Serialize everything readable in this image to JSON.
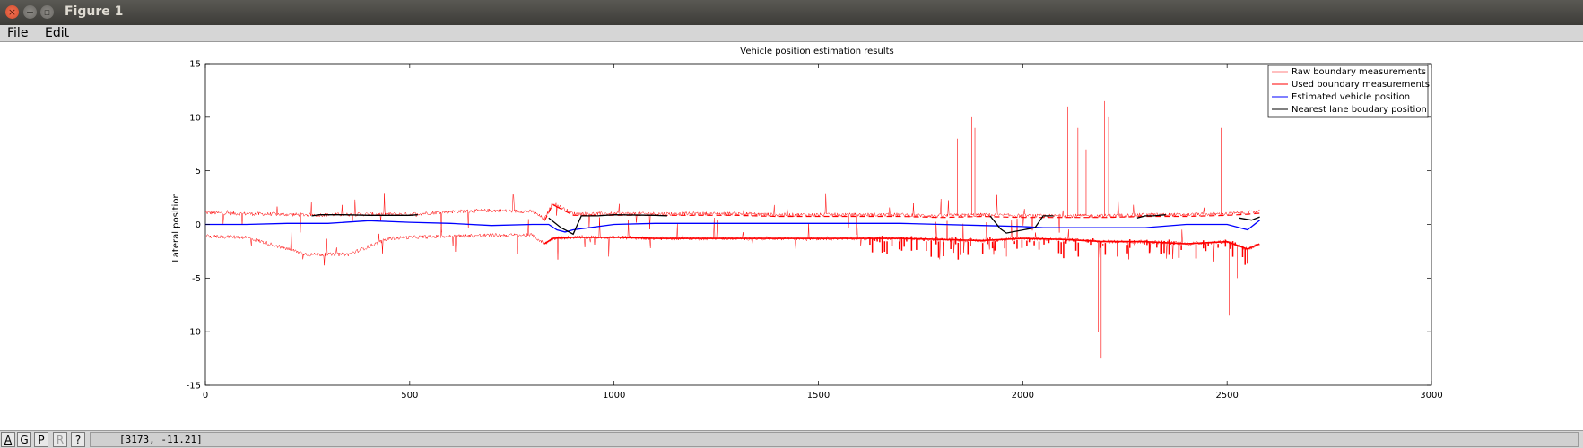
{
  "window": {
    "title": "Figure 1",
    "close_glyph": "×",
    "min_glyph": "−",
    "max_glyph": "▫"
  },
  "menu": {
    "file": "File",
    "edit": "Edit"
  },
  "status": {
    "buttons": [
      "A",
      "G",
      "P",
      "R",
      "?"
    ],
    "coordinates": "[3173, -11.21]"
  },
  "chart_data": {
    "type": "line",
    "title": "Vehicle position estimation results",
    "xlabel": "",
    "ylabel": "Lateral position",
    "xlim": [
      0,
      3000
    ],
    "ylim": [
      -15,
      15
    ],
    "xticks": [
      0,
      500,
      1000,
      1500,
      2000,
      2500,
      3000
    ],
    "yticks": [
      -15,
      -10,
      -5,
      0,
      5,
      10,
      15
    ],
    "grid": false,
    "legend_position": "top-right",
    "series": [
      {
        "name": "Raw boundary measurements",
        "color": "#ff0000",
        "style": "thin",
        "upper_x": [
          0,
          100,
          250,
          300,
          400,
          500,
          600,
          700,
          800,
          830,
          850,
          900,
          1000,
          1100,
          1200,
          1300,
          1400,
          1500,
          1600,
          1700,
          1800,
          1900,
          2000,
          2100,
          2200,
          2300,
          2400,
          2500,
          2550,
          2580
        ],
        "upper_y": [
          1.1,
          1.0,
          0.9,
          0.9,
          0.95,
          0.95,
          1.2,
          1.3,
          1.2,
          0.5,
          2.0,
          1.0,
          1.0,
          1.0,
          1.0,
          1.0,
          0.9,
          0.9,
          0.9,
          0.9,
          0.8,
          0.9,
          0.8,
          0.8,
          0.8,
          0.9,
          0.9,
          1.0,
          1.1,
          1.2
        ],
        "lower_x": [
          0,
          100,
          250,
          350,
          450,
          500,
          600,
          700,
          800,
          830,
          850,
          900,
          1000,
          1100,
          1200,
          1300,
          1400,
          1500,
          1600,
          1700,
          1800,
          1900,
          2000,
          2100,
          2200,
          2300,
          2400,
          2500,
          2550,
          2580
        ],
        "lower_y": [
          -1.1,
          -1.2,
          -2.8,
          -2.8,
          -1.3,
          -1.2,
          -1.1,
          -1.0,
          -1.0,
          -1.8,
          -1.3,
          -1.2,
          -1.2,
          -1.3,
          -1.3,
          -1.3,
          -1.3,
          -1.3,
          -1.3,
          -1.3,
          -1.4,
          -1.5,
          -1.3,
          -1.4,
          -1.6,
          -1.6,
          -1.8,
          -1.6,
          -2.3,
          -1.8
        ],
        "spikes": [
          [
            1840,
            8
          ],
          [
            1875,
            10
          ],
          [
            1883,
            9
          ],
          [
            1960,
            -3
          ],
          [
            2110,
            11
          ],
          [
            2135,
            9
          ],
          [
            2155,
            7
          ],
          [
            2185,
            -10
          ],
          [
            2192,
            -12.5
          ],
          [
            2200,
            11.5
          ],
          [
            2210,
            10
          ],
          [
            2485,
            9
          ],
          [
            2505,
            -8.5
          ],
          [
            2525,
            -5
          ]
        ]
      },
      {
        "name": "Used boundary measurements",
        "color": "#ff0000",
        "style": "thick",
        "segments": [
          [
            830,
            870
          ],
          [
            860,
            2580
          ]
        ]
      },
      {
        "name": "Estimated vehicle position",
        "color": "#0000ff",
        "x": [
          0,
          100,
          200,
          300,
          400,
          500,
          600,
          700,
          800,
          840,
          860,
          880,
          900,
          1000,
          1100,
          1200,
          1300,
          1400,
          1500,
          1600,
          1700,
          1800,
          1900,
          2000,
          2050,
          2100,
          2200,
          2300,
          2400,
          2500,
          2550,
          2580
        ],
        "y": [
          0.0,
          0.0,
          0.1,
          0.1,
          0.35,
          0.2,
          0.1,
          -0.1,
          0.0,
          0.0,
          -0.5,
          -0.7,
          -0.5,
          0.0,
          0.1,
          0.1,
          0.1,
          0.1,
          0.1,
          0.1,
          0.1,
          0.0,
          -0.1,
          -0.2,
          -0.3,
          -0.3,
          -0.3,
          -0.3,
          0.0,
          0.0,
          -0.5,
          0.4
        ]
      },
      {
        "name": "Nearest lane boudary position",
        "color": "#000000",
        "x": [
          260,
          280,
          340,
          400,
          500,
          520,
          840,
          870,
          900,
          920,
          960,
          1000,
          1100,
          1130,
          1920,
          1945,
          1960,
          2030,
          2050,
          2075,
          2280,
          2300,
          2320,
          2350,
          2530,
          2560,
          2580
        ],
        "y": [
          0.8,
          0.9,
          0.9,
          0.85,
          0.85,
          0.9,
          0.6,
          -0.3,
          -0.9,
          0.8,
          0.8,
          0.9,
          0.85,
          0.8,
          0.8,
          -0.4,
          -0.8,
          -0.3,
          0.8,
          0.8,
          0.6,
          0.8,
          0.8,
          0.9,
          0.6,
          0.4,
          0.7
        ]
      }
    ]
  }
}
